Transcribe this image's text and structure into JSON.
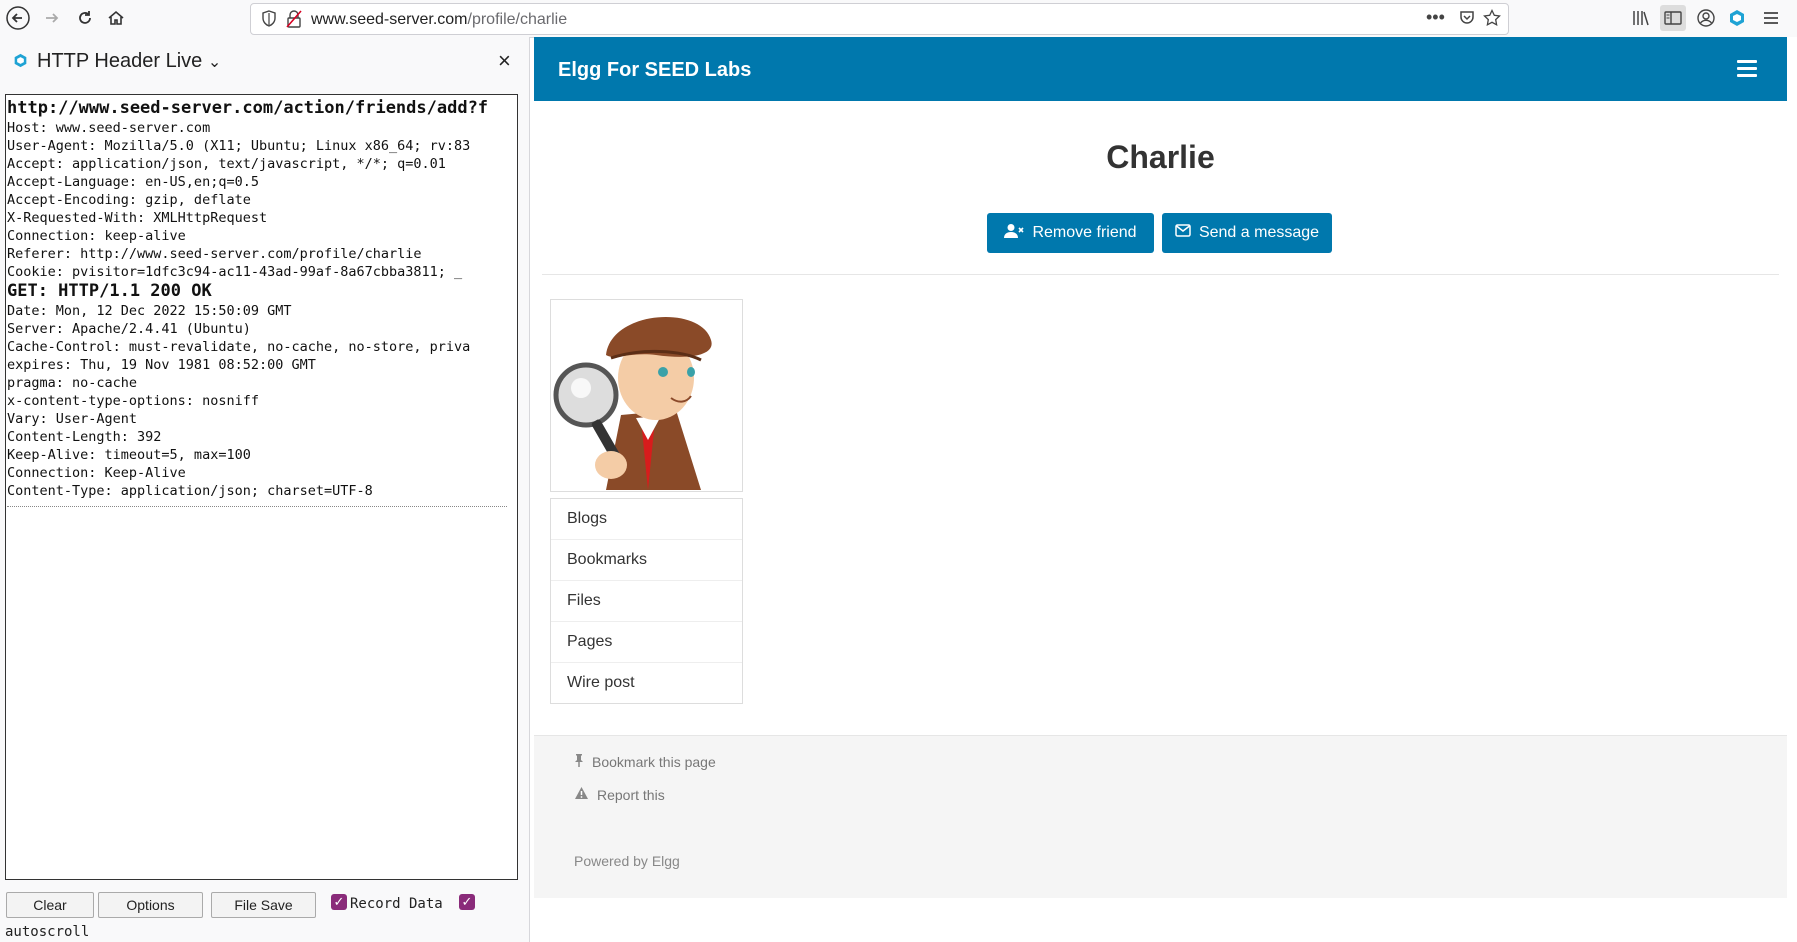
{
  "browser": {
    "url_host": "www.seed-server.com",
    "url_path": "/profile/charlie",
    "icons": [
      "back-icon",
      "forward-icon",
      "reload-icon",
      "home-icon",
      "shield-icon",
      "insecure-lock-icon",
      "more-icon",
      "pocket-icon",
      "star-icon",
      "library-icon",
      "sidebar-icon",
      "account-icon",
      "extension-icon",
      "menu-icon"
    ]
  },
  "sidebar": {
    "title": "HTTP Header Live",
    "chevron": "⌄",
    "close": "×",
    "request_url": "http://www.seed-server.com/action/friends/add?f",
    "request_headers": [
      "Host: www.seed-server.com",
      "User-Agent: Mozilla/5.0 (X11; Ubuntu; Linux x86_64; rv:83",
      "Accept: application/json, text/javascript, */*; q=0.01",
      "Accept-Language: en-US,en;q=0.5",
      "Accept-Encoding: gzip, deflate",
      "X-Requested-With: XMLHttpRequest",
      "Connection: keep-alive",
      "Referer: http://www.seed-server.com/profile/charlie",
      "Cookie: pvisitor=1dfc3c94-ac11-43ad-99af-8a67cbba3811; _"
    ],
    "response_status": "GET: HTTP/1.1 200 OK",
    "response_headers": [
      "Date: Mon, 12 Dec 2022 15:50:09 GMT",
      "Server: Apache/2.4.41 (Ubuntu)",
      "Cache-Control: must-revalidate, no-cache, no-store, priva",
      "expires: Thu, 19 Nov 1981 08:52:00 GMT",
      "pragma: no-cache",
      "x-content-type-options: nosniff",
      "Vary: User-Agent",
      "Content-Length: 392",
      "Keep-Alive: timeout=5, max=100",
      "Connection: Keep-Alive",
      "Content-Type: application/json; charset=UTF-8"
    ],
    "buttons": {
      "clear": "Clear",
      "options": "Options",
      "file_save": "File Save"
    },
    "record_data_label": "Record Data",
    "autoscroll_label": "autoscroll",
    "record_data_checked": true,
    "autoscroll_checked": true
  },
  "elgg": {
    "brand": "Elgg For SEED Labs",
    "profile_name": "Charlie",
    "remove_friend": "Remove friend",
    "send_message": "Send a message",
    "menu": [
      "Blogs",
      "Bookmarks",
      "Files",
      "Pages",
      "Wire post"
    ],
    "footer": {
      "bookmark": "Bookmark this page",
      "report": "Report this",
      "powered": "Powered by Elgg"
    },
    "colors": {
      "brand_blue": "#0078ad",
      "checkbox_purple": "#8a2b7a"
    }
  }
}
